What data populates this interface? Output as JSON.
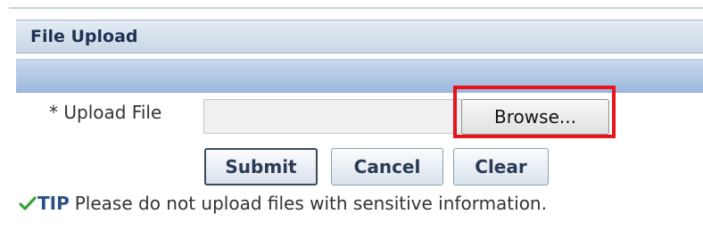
{
  "section": {
    "title": "File Upload"
  },
  "upload_field": {
    "label": "* Upload File",
    "value": "",
    "browse_label": "Browse..."
  },
  "actions": {
    "submit_label": "Submit",
    "cancel_label": "Cancel",
    "clear_label": "Clear"
  },
  "tip": {
    "icon": "checkmark-icon",
    "label": "TIP",
    "text": "Please do not upload files with sensitive information."
  },
  "colors": {
    "header_title": "#1f3252",
    "tip_label": "#2c4f86",
    "highlight": "#e8131b",
    "tip_icon": "#3aa33a"
  }
}
